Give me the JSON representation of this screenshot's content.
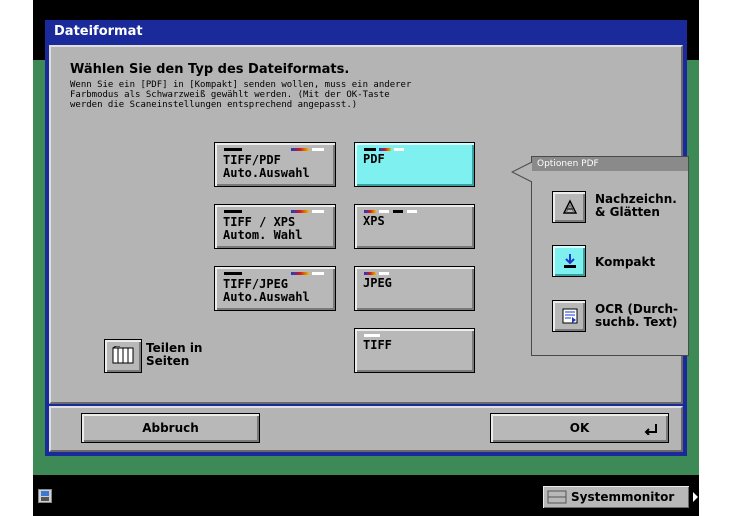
{
  "dialog": {
    "title": "Dateiformat",
    "heading": "Wählen Sie den Typ des Dateiformats.",
    "description": "Wenn Sie ein [PDF] in [Kompakt] senden wollen, muss ein anderer\nFarbmodus als Schwarzweiß gewählt werden. (Mit der OK-Taste\nwerden die Scaneinstellungen entsprechend angepasst.)"
  },
  "formats_left": [
    {
      "label": "TIFF/PDF\nAuto.Auswahl"
    },
    {
      "label": "TIFF / XPS\nAutom. Wahl"
    },
    {
      "label": "TIFF/JPEG\nAuto.Auswahl"
    }
  ],
  "formats_right": [
    {
      "label": "PDF",
      "selected": true
    },
    {
      "label": "XPS",
      "selected": false
    },
    {
      "label": "JPEG",
      "selected": false
    },
    {
      "label": "TIFF",
      "selected": false
    }
  ],
  "split_pages": {
    "label": "Teilen in\nSeiten"
  },
  "pdf_options": {
    "title": "Optionen PDF",
    "items": [
      {
        "label": "Nachzeichn.\n& Glätten",
        "icon": "trace-smooth-icon",
        "selected": false
      },
      {
        "label": "Kompakt",
        "icon": "compact-icon",
        "selected": true
      },
      {
        "label": "OCR (Durch-\nsuchb. Text)",
        "icon": "ocr-icon",
        "selected": false
      }
    ]
  },
  "footer": {
    "cancel_label": "Abbruch",
    "ok_label": "OK"
  },
  "status_bar": {
    "system_monitor_label": "Systemmonitor"
  },
  "colors": {
    "dialog_frame": "#1a2a9a",
    "panel": "#b4b4b4",
    "selected": "#7ef0f0",
    "background_green": "#3d8a56"
  }
}
